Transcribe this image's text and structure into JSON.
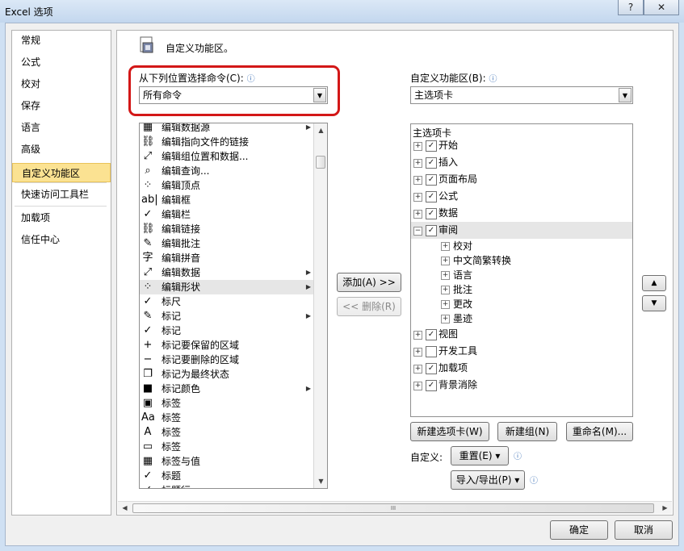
{
  "window": {
    "title": "Excel 选项",
    "help_label": "?",
    "close_label": "✕"
  },
  "nav": {
    "items": [
      "常规",
      "公式",
      "校对",
      "保存",
      "语言",
      "高级",
      "自定义功能区",
      "快速访问工具栏",
      "加载项",
      "信任中心"
    ],
    "selected": "自定义功能区"
  },
  "header": {
    "title": "自定义功能区。"
  },
  "left": {
    "label": "从下列位置选择命令(C):",
    "combo_value": "所有命令",
    "commands": [
      {
        "icon": "▦",
        "label": "编辑数据源",
        "submenu": true
      },
      {
        "icon": "⛓",
        "label": "编辑指向文件的链接"
      },
      {
        "icon": "⤢",
        "label": "编辑组位置和数据..."
      },
      {
        "icon": "⌕",
        "label": "编辑查询..."
      },
      {
        "icon": "⁘",
        "label": "编辑顶点"
      },
      {
        "icon": "ab|",
        "label": "编辑框"
      },
      {
        "icon": "✓",
        "label": "编辑栏"
      },
      {
        "icon": "⛓",
        "label": "编辑链接"
      },
      {
        "icon": "✎",
        "label": "编辑批注"
      },
      {
        "icon": "字",
        "label": "编辑拼音"
      },
      {
        "icon": "⤢",
        "label": "编辑数据",
        "submenu": true
      },
      {
        "icon": "⁘",
        "label": "编辑形状",
        "submenu": true,
        "highlight": true
      },
      {
        "icon": "✓",
        "label": "标尺"
      },
      {
        "icon": "✎",
        "label": "标记",
        "submenu": true
      },
      {
        "icon": "✓",
        "label": "标记"
      },
      {
        "icon": "+",
        "label": "标记要保留的区域"
      },
      {
        "icon": "−",
        "label": "标记要删除的区域"
      },
      {
        "icon": "❐",
        "label": "标记为最终状态"
      },
      {
        "icon": "■",
        "label": "标记颜色",
        "submenu": true
      },
      {
        "icon": "▣",
        "label": "标签"
      },
      {
        "icon": "Aa",
        "label": "标签"
      },
      {
        "icon": "A",
        "label": "标签"
      },
      {
        "icon": "▭",
        "label": "标签"
      },
      {
        "icon": "▦",
        "label": "标签与值"
      },
      {
        "icon": "✓",
        "label": "标题"
      },
      {
        "icon": "✓",
        "label": "标题行"
      }
    ]
  },
  "middle": {
    "add_label": "添加(A) >>",
    "remove_label": "<< 删除(R)"
  },
  "right": {
    "label": "自定义功能区(B):",
    "combo_value": "主选项卡",
    "tree_header": "主选项卡",
    "tabs": [
      {
        "label": "开始",
        "checked": true,
        "expanded": false
      },
      {
        "label": "插入",
        "checked": true,
        "expanded": false
      },
      {
        "label": "页面布局",
        "checked": true,
        "expanded": false
      },
      {
        "label": "公式",
        "checked": true,
        "expanded": false
      },
      {
        "label": "数据",
        "checked": true,
        "expanded": false
      },
      {
        "label": "审阅",
        "checked": true,
        "expanded": true,
        "selected": true,
        "groups": [
          "校对",
          "中文简繁转换",
          "语言",
          "批注",
          "更改",
          "墨迹"
        ]
      },
      {
        "label": "视图",
        "checked": true,
        "expanded": false
      },
      {
        "label": "开发工具",
        "checked": false,
        "expanded": false
      },
      {
        "label": "加载项",
        "checked": true,
        "expanded": false
      },
      {
        "label": "背景消除",
        "checked": true,
        "expanded": false
      }
    ],
    "new_tab_label": "新建选项卡(W)",
    "new_group_label": "新建组(N)",
    "rename_label": "重命名(M)...",
    "customize_label": "自定义:",
    "reset_label": "重置(E) ▾",
    "import_export_label": "导入/导出(P) ▾"
  },
  "scroll": {
    "hscroll_grip": "III"
  },
  "footer": {
    "ok_label": "确定",
    "cancel_label": "取消"
  },
  "icons": {
    "checkmark": "✓",
    "expand": "+",
    "collapse": "−",
    "dropdown": "▼",
    "up": "▲",
    "down": "▼",
    "info": "ⓘ"
  }
}
